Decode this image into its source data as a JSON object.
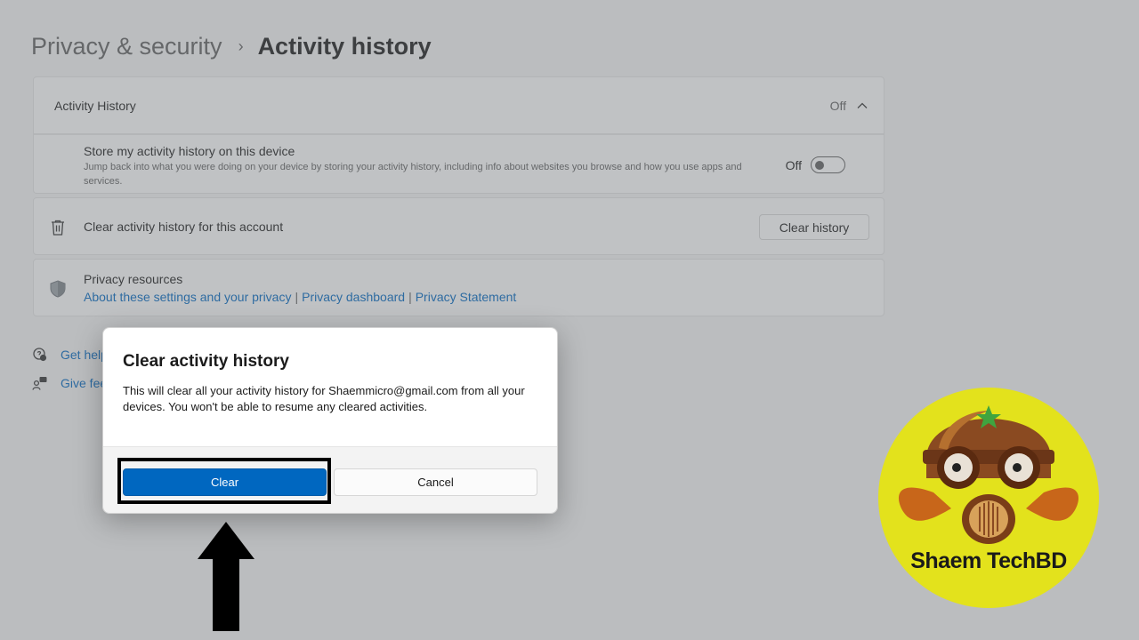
{
  "breadcrumb": {
    "parent": "Privacy & security",
    "separator": "›",
    "current": "Activity history"
  },
  "activity_header": {
    "title": "Activity History",
    "state": "Off"
  },
  "store_setting": {
    "title": "Store my activity history on this device",
    "description": "Jump back into what you were doing on your device by storing your activity history, including info about websites you browse and how you use apps and services.",
    "state": "Off",
    "toggle_on": false
  },
  "clear_setting": {
    "label": "Clear activity history for this account",
    "button": "Clear history"
  },
  "resources": {
    "title": "Privacy resources",
    "links": [
      "About these settings and your privacy",
      "Privacy dashboard",
      "Privacy Statement"
    ],
    "separator": "|"
  },
  "side_links": {
    "get_help": "Get help",
    "give_feedback": "Give feedback"
  },
  "dialog": {
    "title": "Clear activity history",
    "body": "This will clear all your activity history for Shaemmicro@gmail.com from all your devices. You won't be able to resume any cleared activities.",
    "primary_button": "Clear",
    "secondary_button": "Cancel"
  },
  "watermark": {
    "text": "Shaem TechBD"
  },
  "colors": {
    "accent": "#0067c0",
    "link": "#0067c0",
    "logo_yellow": "#e3e21c",
    "overlay": "#6e7378"
  }
}
